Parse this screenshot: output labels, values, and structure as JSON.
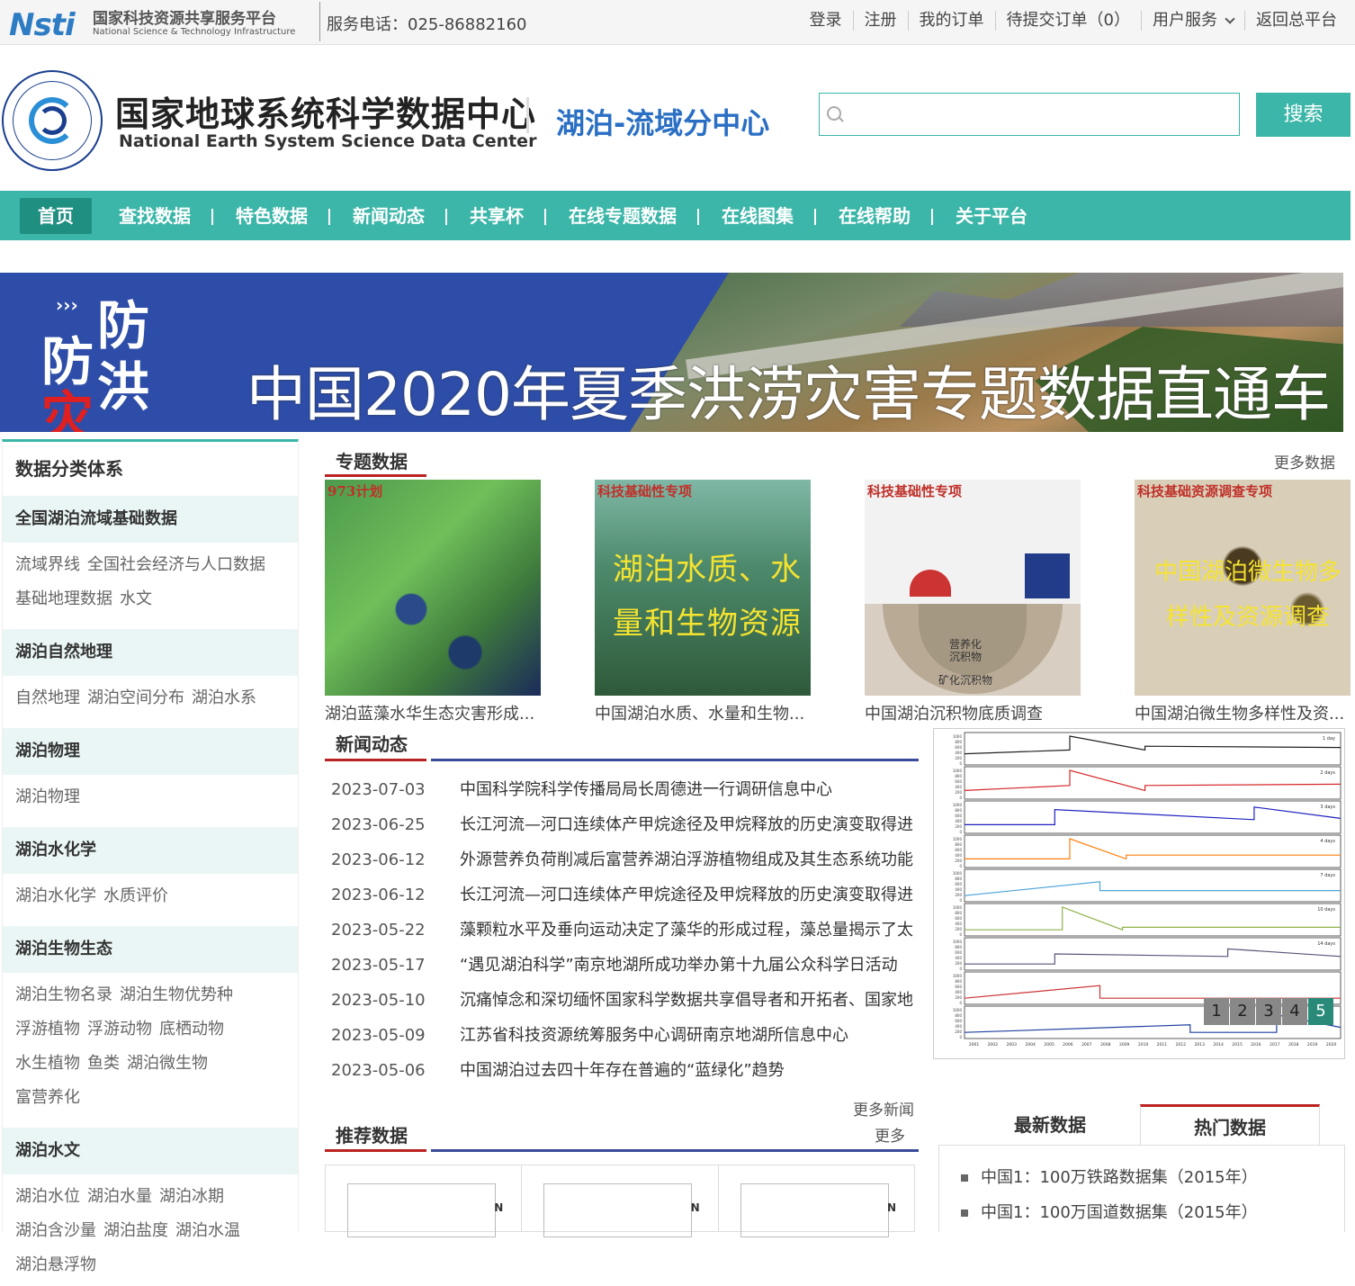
{
  "topbar": {
    "logo_word": "Nsti",
    "logo_cn": "国家科技资源共享服务平台",
    "logo_en": "National Science & Technology Infrastructure",
    "phone": "服务电话：025-86882160",
    "links": [
      "登录",
      "注册",
      "我的订单",
      "待提交订单（0）",
      "用户服务",
      "返回总平台"
    ]
  },
  "header": {
    "center_cn": "国家地球系统科学数据中心",
    "center_en": "National Earth System Science Data Center",
    "subcenter": "湖泊-流域分中心",
    "search_placeholder": "",
    "search_button": "搜索"
  },
  "nav": {
    "items": [
      "首页",
      "查找数据",
      "特色数据",
      "新闻动态",
      "共享杯",
      "在线专题数据",
      "在线图集",
      "在线帮助",
      "关于平台"
    ],
    "active": "首页"
  },
  "banner": {
    "arrows": "›››",
    "c1": "防",
    "c2": "防",
    "c3": "洪",
    "c4": "灾",
    "title": "中国2020年夏季洪涝灾害专题数据直通车"
  },
  "left": {
    "title": "数据分类体系",
    "categories": [
      {
        "name": "全国湖泊流域基础数据",
        "items": [
          "流域界线",
          "全国社会经济与人口数据",
          "基础地理数据",
          "水文"
        ]
      },
      {
        "name": "湖泊自然地理",
        "items": [
          "自然地理",
          "湖泊空间分布",
          "湖泊水系"
        ]
      },
      {
        "name": "湖泊物理",
        "items": [
          "湖泊物理"
        ]
      },
      {
        "name": "湖泊水化学",
        "items": [
          "湖泊水化学",
          "水质评价"
        ]
      },
      {
        "name": "湖泊生物生态",
        "items": [
          "湖泊生物名录",
          "湖泊生物优势种",
          "浮游植物",
          "浮游动物",
          "底栖动物",
          "水生植物",
          "鱼类",
          "湖泊微生物",
          "富营养化"
        ]
      },
      {
        "name": "湖泊水文",
        "items": [
          "湖泊水位",
          "湖泊水量",
          "湖泊冰期",
          "湖泊含沙量",
          "湖泊盐度",
          "湖泊水温",
          "湖泊悬浮物"
        ]
      }
    ]
  },
  "topics": {
    "title": "专题数据",
    "more": "更多数据",
    "cards": [
      {
        "tag": "973计划",
        "caption": "湖泊蓝藻水华生态灾害形成...",
        "image_text": ""
      },
      {
        "tag": "科技基础性专项",
        "caption": "中国湖泊水质、水量和生物...",
        "image_text": "湖泊水质、水量和生物资源"
      },
      {
        "tag": "科技基础性专项",
        "caption": "中国湖泊沉积物底质调查",
        "image_text": "营养化沉积物",
        "image_text2": "矿化沉积物"
      },
      {
        "tag": "科技基础资源调查专项",
        "caption": "中国湖泊微生物多样性及资...",
        "image_text": "中国湖泊微生物多样性及资源调查"
      }
    ]
  },
  "news": {
    "title": "新闻动态",
    "more": "更多新闻",
    "items": [
      {
        "date": "2023-07-03",
        "title": "中国科学院科学传播局局长周德进一行调研信息中心"
      },
      {
        "date": "2023-06-25",
        "title": "长江河流—河口连续体产甲烷途径及甲烷释放的历史演变取得进"
      },
      {
        "date": "2023-06-12",
        "title": "外源营养负荷削减后富营养湖泊浮游植物组成及其生态系统功能"
      },
      {
        "date": "2023-06-12",
        "title": "长江河流—河口连续体产甲烷途径及甲烷释放的历史演变取得进"
      },
      {
        "date": "2023-05-22",
        "title": "藻颗粒水平及垂向运动决定了藻华的形成过程，藻总量揭示了太"
      },
      {
        "date": "2023-05-17",
        "title": "“遇见湖泊科学”南京地湖所成功举办第十九届公众科学日活动"
      },
      {
        "date": "2023-05-10",
        "title": "沉痛悼念和深切缅怀国家科学数据共享倡导者和开拓者、国家地"
      },
      {
        "date": "2023-05-09",
        "title": "江苏省科技资源统筹服务中心调研南京地湖所信息中心"
      },
      {
        "date": "2023-05-06",
        "title": "中国湖泊过去四十年存在普遍的“蓝绿化”趋势"
      }
    ]
  },
  "slider": {
    "pages": [
      "1",
      "2",
      "3",
      "4",
      "5"
    ],
    "active": "5",
    "panel_labels": [
      "1 day",
      "2 days",
      "3 days",
      "4 days",
      "7 days",
      "10 days",
      "14 days",
      "",
      ""
    ],
    "x_ticks": [
      "2001",
      "2002",
      "2003",
      "2004",
      "2005",
      "2006",
      "2007",
      "2008",
      "2009",
      "2010",
      "2011",
      "2012",
      "2013",
      "2014",
      "2015",
      "2016",
      "2017",
      "2018",
      "2019",
      "2020"
    ],
    "colors": [
      "#222222",
      "#d62728",
      "#1f1fbf",
      "#ff7f0e",
      "#4aa3d9",
      "#8fb34a",
      "#555577",
      "#cc3333",
      "#1f3f9f"
    ]
  },
  "recommend": {
    "title": "推荐数据",
    "more": "更多",
    "north": "N"
  },
  "datatabs": {
    "tabs": [
      "最新数据",
      "热门数据"
    ],
    "active": "热门数据",
    "items": [
      "中国1：100万铁路数据集（2015年）",
      "中国1：100万国道数据集（2015年）"
    ]
  }
}
